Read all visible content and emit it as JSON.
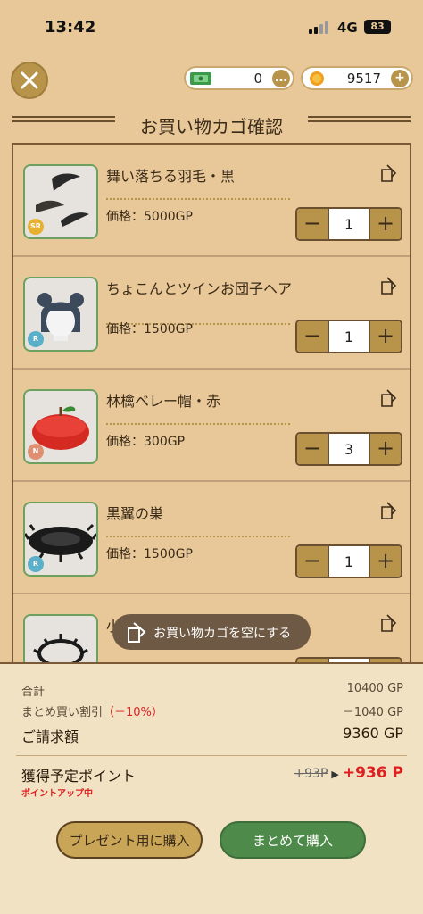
{
  "status_bar": {
    "time": "13:42",
    "network": "4G",
    "battery": "83"
  },
  "currency": {
    "tickets": "0",
    "gold": "9517"
  },
  "header": {
    "title": "お買い物カゴ確認"
  },
  "items": [
    {
      "name": "舞い落ちる羽毛・黒",
      "price": "価格：5000GP",
      "rarity": "SR",
      "qty": "1"
    },
    {
      "name": "ちょこんとツインお団子ヘア",
      "price": "価格：1500GP",
      "rarity": "R",
      "qty": "1"
    },
    {
      "name": "林檎ベレー帽・赤",
      "price": "価格：300GP",
      "rarity": "N",
      "qty": "3"
    },
    {
      "name": "黒翼の巣",
      "price": "価格：1500GP",
      "rarity": "R",
      "qty": "1"
    },
    {
      "name": "小",
      "price": "",
      "rarity": "",
      "qty": ""
    }
  ],
  "clear_cart": {
    "label": "お買い物カゴを空にする"
  },
  "summary": {
    "total_label": "合計",
    "total_value": "10400 GP",
    "discount_label": "まとめ買い割引",
    "discount_rate": "（－10%）",
    "discount_value": "－1040 GP",
    "billing_label": "ご請求額",
    "billing_value": "9360 GP",
    "points_label": "獲得予定ポイント",
    "points_old": "+93P",
    "points_new": "+936 P",
    "points_badge": "ポイントアップ中"
  },
  "buttons": {
    "gift": "プレゼント用に購入",
    "buy": "まとめて購入"
  },
  "colors": {
    "background": "#e8c898",
    "accent": "#b8934a",
    "buy": "#4e8a4a",
    "highlight": "#e02020"
  }
}
